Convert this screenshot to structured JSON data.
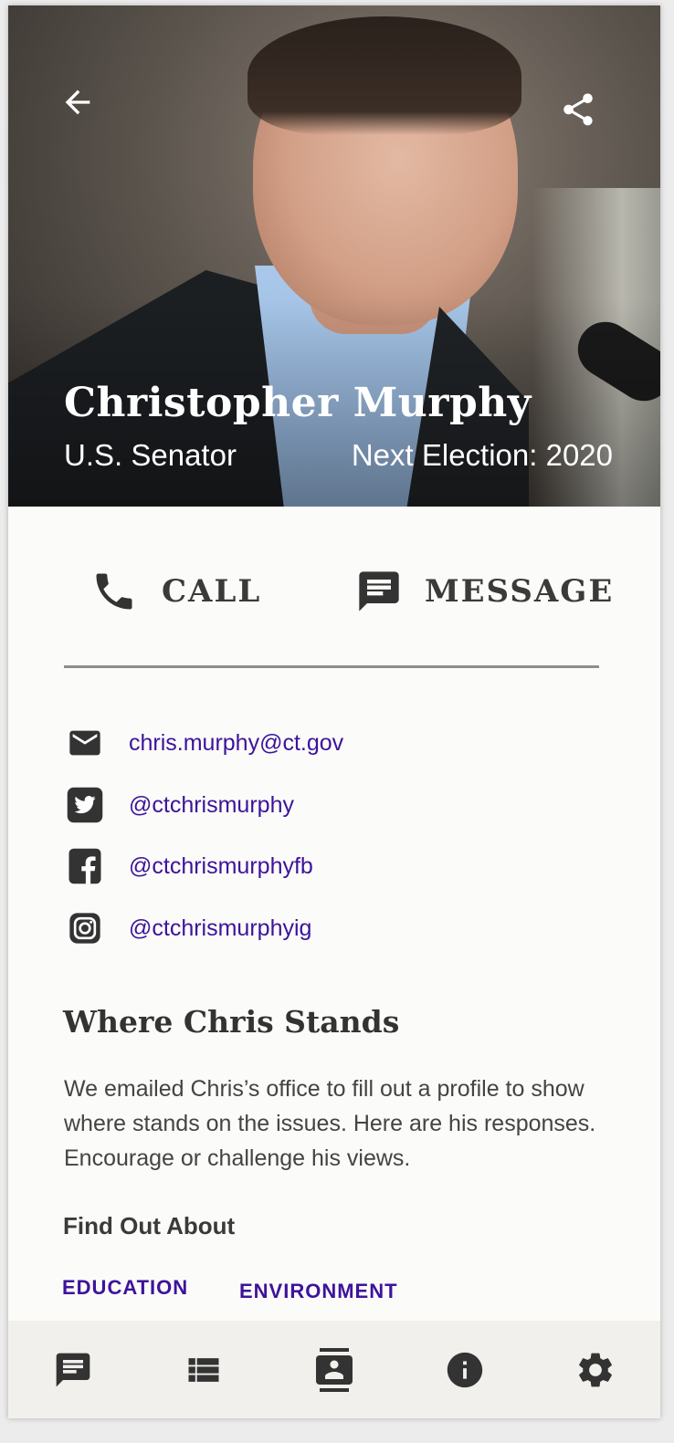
{
  "hero": {
    "name": "Christopher Murphy",
    "role": "U.S. Senator",
    "election": "Next Election: 2020"
  },
  "actions": {
    "call_label": "CALL",
    "message_label": "MESSAGE"
  },
  "contacts": {
    "email": "chris.murphy@ct.gov",
    "twitter": "@ctchrismurphy",
    "facebook": "@ctchrismurphyfb",
    "instagram": "@ctchrismurphyig"
  },
  "stances": {
    "title": "Where Chris Stands",
    "body": "We emailed Chris’s office to fill out a profile to show where stands on the issues. Here are his responses. Encourage or challenge his views.",
    "find_out_label": "Find Out About",
    "topics": [
      "EDUCATION",
      "ENVIRONMENT"
    ]
  },
  "icons": {
    "back": "arrow-back-icon",
    "share": "share-icon",
    "call": "phone-icon",
    "message": "message-icon",
    "email": "email-icon",
    "twitter": "twitter-icon",
    "facebook": "facebook-icon",
    "instagram": "instagram-icon",
    "nav": [
      "chat-icon",
      "list-icon",
      "contact-card-icon",
      "info-icon",
      "settings-gear-icon"
    ]
  },
  "colors": {
    "link": "#3d139b",
    "text": "#3a3a3a",
    "nav_bg": "#f2f0ec",
    "page_bg": "#fbfbf9"
  }
}
